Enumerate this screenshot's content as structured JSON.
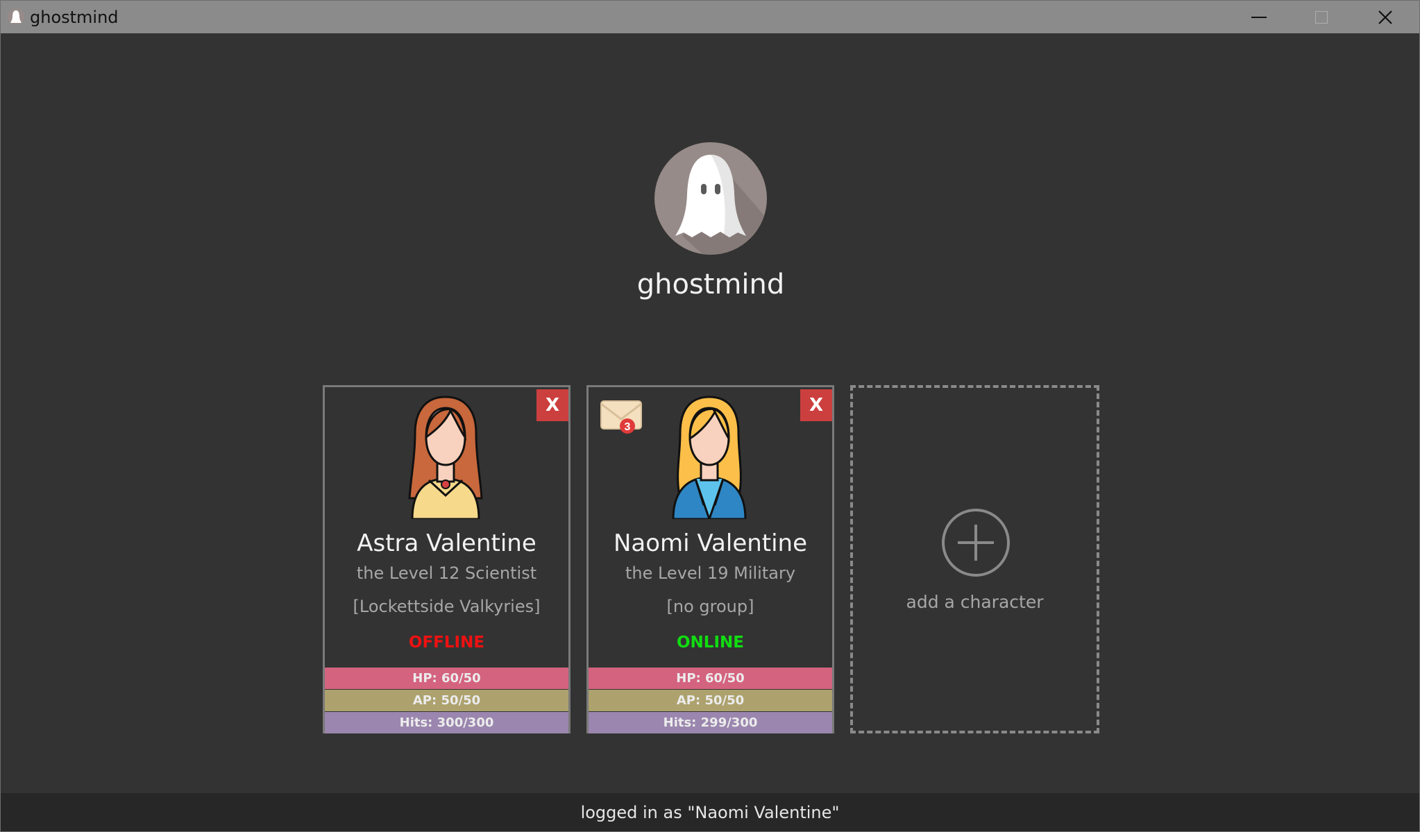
{
  "window": {
    "title": "ghostmind",
    "icon": "ghost-icon"
  },
  "profile": {
    "avatar_icon": "ghost-icon",
    "username": "ghostmind"
  },
  "characters": [
    {
      "name": "Astra Valentine",
      "class_line": "the Level 12 Scientist",
      "group": "[Lockettside Valkyries]",
      "status": "OFFLINE",
      "status_color": "#ee1111",
      "remove_label": "X",
      "hp": "HP: 60/50",
      "ap": "AP: 50/50",
      "hits": "Hits: 300/300",
      "portrait": "female-red-hair-avatar"
    },
    {
      "name": "Naomi Valentine",
      "class_line": "the Level 19 Military",
      "group": "[no group]",
      "status": "ONLINE",
      "status_color": "#11dd11",
      "remove_label": "X",
      "hp": "HP: 60/50",
      "ap": "AP: 50/50",
      "hits": "Hits: 299/300",
      "portrait": "female-blonde-avatar",
      "mail_count": "3"
    }
  ],
  "add_character": {
    "label": "add a character",
    "icon": "plus-circle-icon"
  },
  "statusbar": {
    "text": "logged in as \"Naomi Valentine\""
  },
  "colors": {
    "background": "#333333",
    "titlebar": "#8b8b8b",
    "remove": "#cc3f3f",
    "hp": "#d4637f",
    "ap": "#ada26e",
    "hits": "#9a86ae"
  }
}
